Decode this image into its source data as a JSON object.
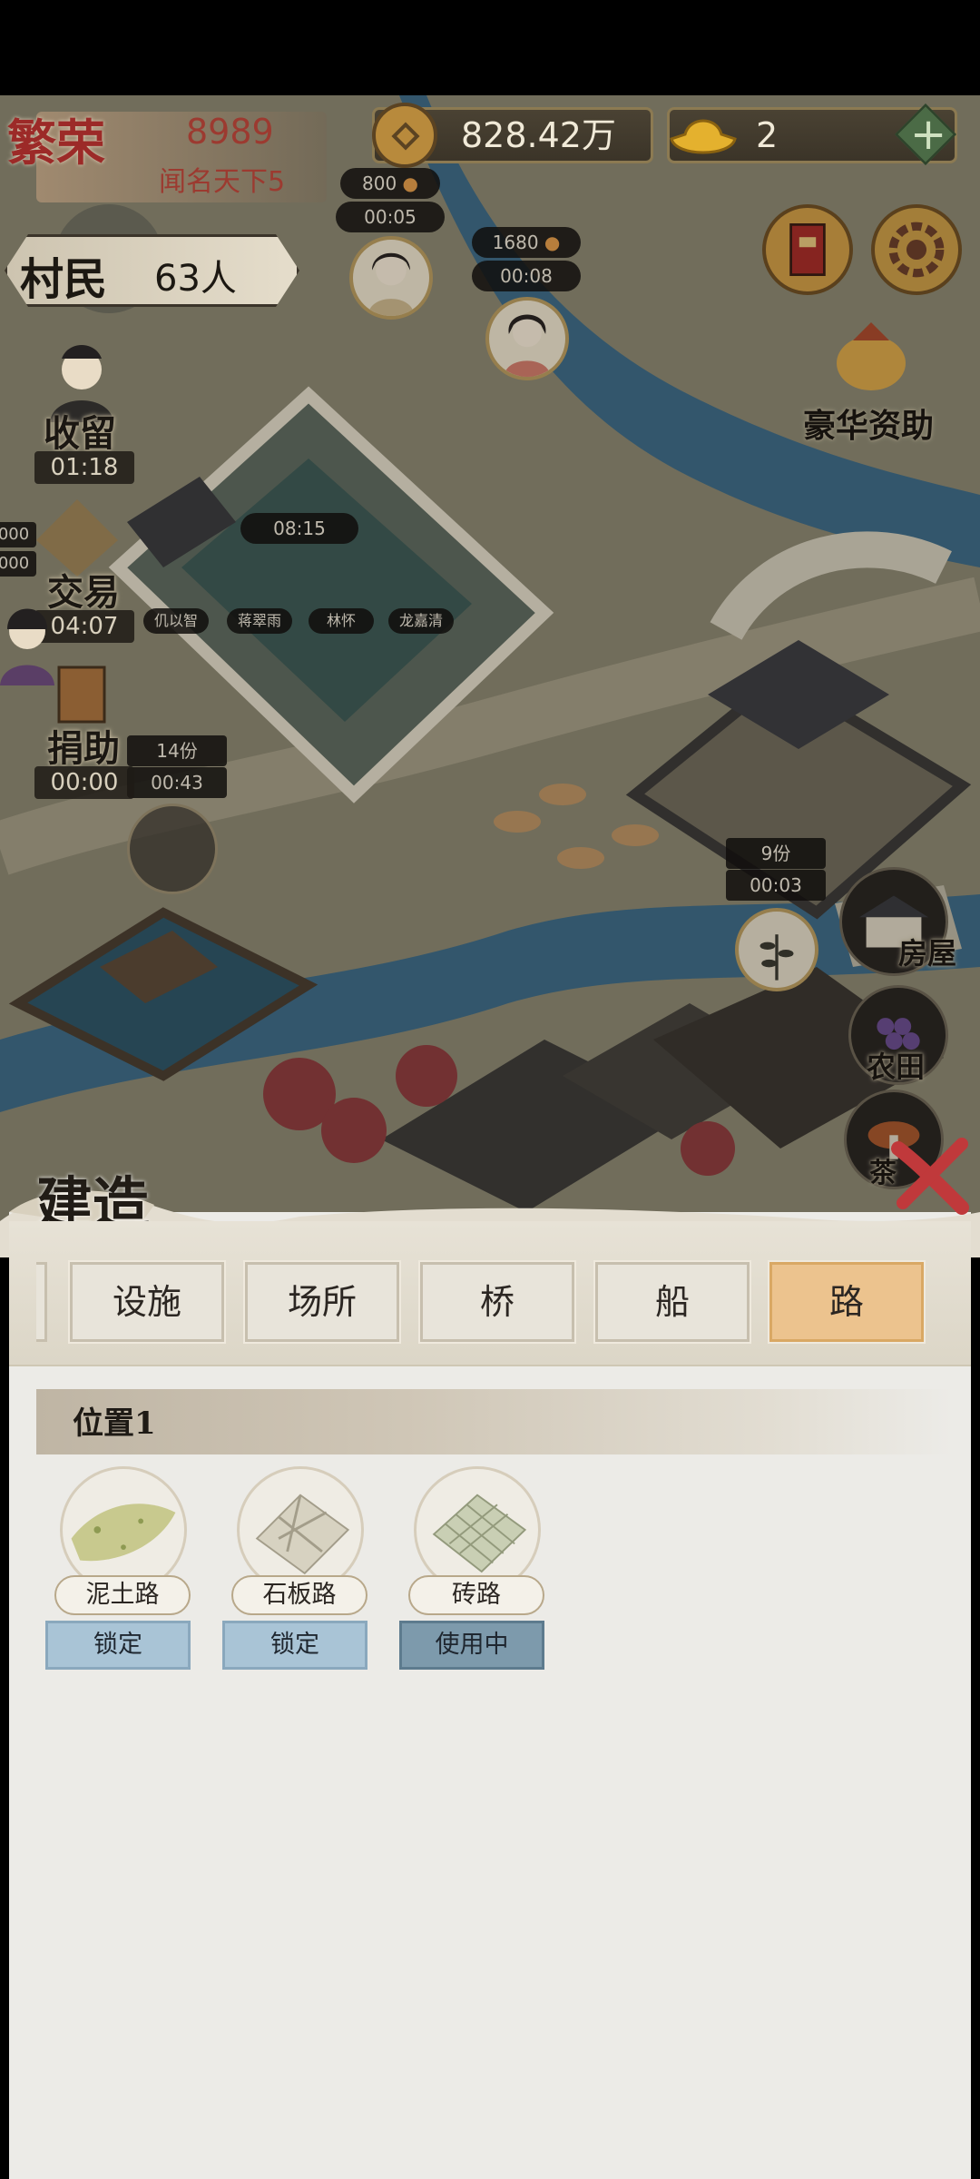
{
  "topbar": {
    "prosperity_label": "繁荣",
    "prosperity_value": "8989",
    "prosperity_rank": "闻名天下5",
    "coins": "828.42万",
    "gold": "2",
    "plus_icon": "plus-icon"
  },
  "villagers": {
    "label": "村民",
    "count": "63人"
  },
  "side_menu": [
    {
      "label": "收留",
      "timer": "01:18"
    },
    {
      "label": "交易",
      "timer": "04:07"
    },
    {
      "label": "捐助",
      "timer": "00:00"
    }
  ],
  "map_labels": {
    "npc1_price": "800",
    "npc1_time": "00:05",
    "npc2_price": "1680",
    "npc2_time": "00:08",
    "edge_top": "000",
    "edge_bottom": "000",
    "garden_time": "08:15",
    "garden_people": [
      "仉以智",
      "蒋翠雨",
      "林怀",
      "龙嘉清"
    ],
    "pond_count": "14份",
    "pond_time": "00:43",
    "farm_count": "9份",
    "farm_time": "00:03",
    "luxury_aid": "豪华资助",
    "house": "房屋",
    "farmland": "农田",
    "partial_label": "茶"
  },
  "build_panel": {
    "title": "建造",
    "tabs": [
      "设施",
      "场所",
      "桥",
      "船",
      "路"
    ],
    "active_tab": "路",
    "section": "位置1",
    "roads": [
      {
        "name": "泥土路",
        "status": "锁定",
        "icon": "dirt-road-icon"
      },
      {
        "name": "石板路",
        "status": "锁定",
        "icon": "flagstone-road-icon"
      },
      {
        "name": "砖路",
        "status": "使用中",
        "icon": "brick-road-icon"
      }
    ]
  },
  "colors": {
    "active_tab": "#ecc38e",
    "locked_button": "#a9c4d6",
    "in_use_button": "#7d9aac",
    "close_x": "#c0393b"
  }
}
